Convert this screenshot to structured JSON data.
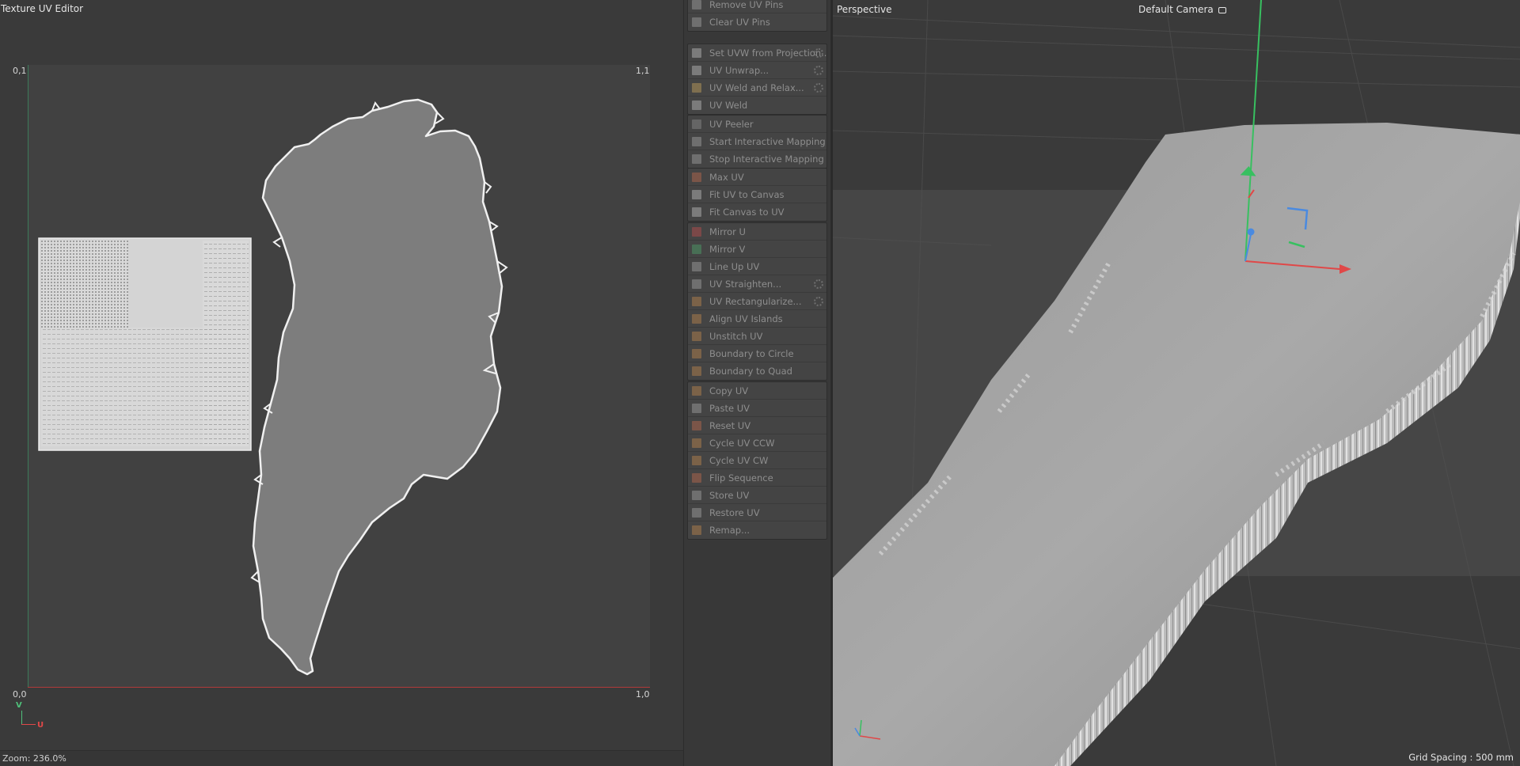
{
  "uv_editor": {
    "title": "Texture UV Editor",
    "corners": {
      "top_left": "0,1",
      "top_right": "1,1",
      "bottom_left": "0,0",
      "bottom_right": "1,0"
    },
    "axis_v_label": "V",
    "axis_u_label": "U",
    "zoom": "Zoom: 236.0%"
  },
  "palette": {
    "groups": [
      {
        "items": [
          {
            "label": "Remove UV Pins",
            "icon": "remove-pins-icon",
            "color": "#7a7a7a"
          },
          {
            "label": "Clear UV Pins",
            "icon": "clear-pins-icon",
            "color": "#7a7a7a"
          }
        ]
      },
      {
        "items": [
          {
            "label": "Set UVW from Projection...",
            "icon": "projection-icon",
            "color": "#8a8a8a",
            "gear": true
          },
          {
            "label": "UV Unwrap...",
            "icon": "unwrap-icon",
            "color": "#8a8a8a",
            "gear": true
          },
          {
            "label": "UV Weld and Relax...",
            "icon": "weld-relax-icon",
            "color": "#8f7a52",
            "gear": true
          },
          {
            "label": "UV Weld",
            "icon": "weld-icon",
            "color": "#8a8a8a"
          }
        ]
      },
      {
        "items": [
          {
            "label": "UV Peeler",
            "icon": "peeler-icon",
            "color": "#6e6e6e"
          },
          {
            "label": "Start Interactive Mapping",
            "icon": "start-mapping-icon",
            "color": "#7a7a7a"
          },
          {
            "label": "Stop Interactive Mapping",
            "icon": "stop-mapping-icon",
            "color": "#7a7a7a"
          }
        ]
      },
      {
        "items": [
          {
            "label": "Max UV",
            "icon": "max-uv-icon",
            "color": "#8a5a4a"
          },
          {
            "label": "Fit UV to Canvas",
            "icon": "fit-uv-icon",
            "color": "#8a8a8a"
          },
          {
            "label": "Fit Canvas to UV",
            "icon": "fit-canvas-icon",
            "color": "#8a8a8a"
          }
        ]
      },
      {
        "items": [
          {
            "label": "Mirror U",
            "icon": "mirror-u-icon",
            "color": "#8a4a4a"
          },
          {
            "label": "Mirror V",
            "icon": "mirror-v-icon",
            "color": "#4a7a5a"
          },
          {
            "label": "Line Up UV",
            "icon": "line-up-icon",
            "color": "#7a7a7a"
          },
          {
            "label": "UV Straighten...",
            "icon": "straighten-icon",
            "color": "#7a7a7a",
            "gear": true
          },
          {
            "label": "UV Rectangularize...",
            "icon": "rectangularize-icon",
            "color": "#8a6a4a",
            "gear": true
          },
          {
            "label": "Align UV Islands",
            "icon": "align-islands-icon",
            "color": "#8a6a4a"
          },
          {
            "label": "Unstitch UV",
            "icon": "unstitch-icon",
            "color": "#8a6a4a"
          },
          {
            "label": "Boundary to Circle",
            "icon": "boundary-circle-icon",
            "color": "#8a6a4a"
          },
          {
            "label": "Boundary to Quad",
            "icon": "boundary-quad-icon",
            "color": "#8a6a4a"
          }
        ]
      },
      {
        "items": [
          {
            "label": "Copy UV",
            "icon": "copy-uv-icon",
            "color": "#8a6a4a"
          },
          {
            "label": "Paste UV",
            "icon": "paste-uv-icon",
            "color": "#7a7a7a"
          },
          {
            "label": "Reset UV",
            "icon": "reset-uv-icon",
            "color": "#8a5a4a"
          },
          {
            "label": "Cycle UV CCW",
            "icon": "cycle-ccw-icon",
            "color": "#8a6a4a"
          },
          {
            "label": "Cycle UV CW",
            "icon": "cycle-cw-icon",
            "color": "#8a6a4a"
          },
          {
            "label": "Flip Sequence",
            "icon": "flip-sequence-icon",
            "color": "#8a5a4a"
          },
          {
            "label": "Store UV",
            "icon": "store-uv-icon",
            "color": "#7a7a7a"
          },
          {
            "label": "Restore UV",
            "icon": "restore-uv-icon",
            "color": "#7a7a7a"
          },
          {
            "label": "Remap...",
            "icon": "remap-icon",
            "color": "#8a6a4a"
          }
        ]
      }
    ]
  },
  "viewport": {
    "title": "Perspective",
    "camera": "Default Camera",
    "grid_spacing": "Grid Spacing : 500 mm",
    "colors": {
      "axis_x": "#e04848",
      "axis_y": "#38c060",
      "axis_z": "#4a8ae0"
    }
  }
}
